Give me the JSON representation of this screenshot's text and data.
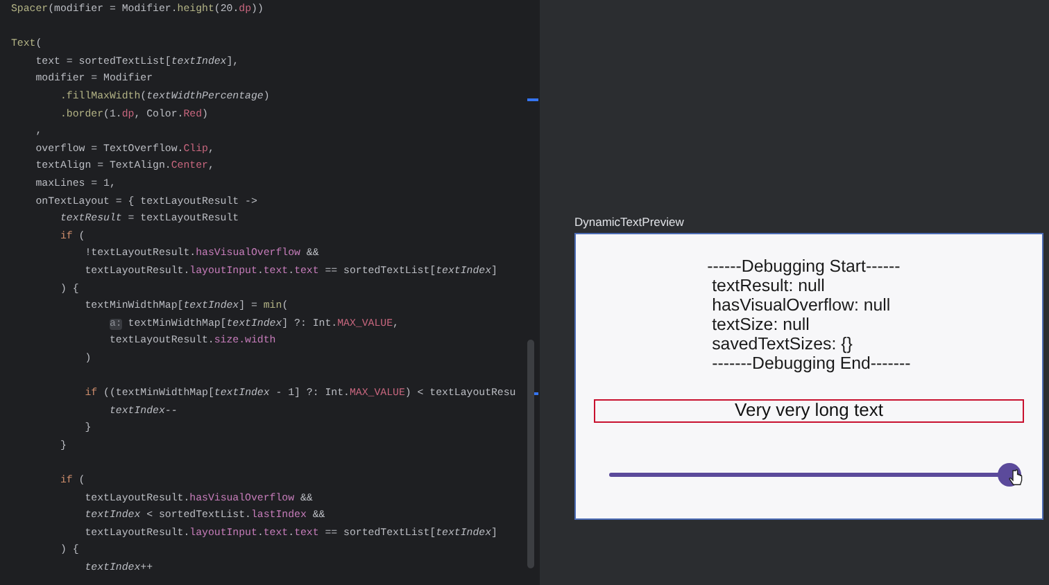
{
  "editor": {
    "lines": [
      {
        "tokens": [
          {
            "t": "Spacer",
            "kind": "fn"
          },
          {
            "t": "(modifier = Modifier.",
            "kind": "p"
          },
          {
            "t": "height",
            "kind": "fn"
          },
          {
            "t": "(20.",
            "kind": "p"
          },
          {
            "t": "dp",
            "kind": "c"
          },
          {
            "t": "))",
            "kind": "p"
          }
        ]
      },
      {
        "kind": "blank"
      },
      {
        "kind": "code",
        "tokens": [
          {
            "t": "Text",
            "kind": "fn"
          },
          {
            "t": "(",
            "kind": "p"
          }
        ]
      },
      {
        "tokens": [
          {
            "t": "    text = sortedTextList[",
            "kind": "p"
          },
          {
            "t": "textIndex",
            "kind": "i"
          },
          {
            "t": "],",
            "kind": "p"
          }
        ]
      },
      {
        "tokens": [
          {
            "t": "    modifier = Modifier",
            "kind": "p"
          }
        ]
      },
      {
        "tokens": [
          {
            "t": "        .fillMaxWidth",
            "kind": "fn"
          },
          {
            "t": "(",
            "kind": "p"
          },
          {
            "t": "textWidthPercentage",
            "kind": "i"
          },
          {
            "t": ")",
            "kind": "p"
          }
        ]
      },
      {
        "tokens": [
          {
            "t": "        .border",
            "kind": "fn"
          },
          {
            "t": "(1.",
            "kind": "p"
          },
          {
            "t": "dp",
            "kind": "c"
          },
          {
            "t": ", Color.",
            "kind": "p"
          },
          {
            "t": "Red",
            "kind": "c"
          },
          {
            "t": ")",
            "kind": "p"
          }
        ]
      },
      {
        "tokens": [
          {
            "t": "    ,",
            "kind": "p"
          }
        ]
      },
      {
        "tokens": [
          {
            "t": "    overflow = TextOverflow.",
            "kind": "p"
          },
          {
            "t": "Clip",
            "kind": "c"
          },
          {
            "t": ",",
            "kind": "p"
          }
        ]
      },
      {
        "tokens": [
          {
            "t": "    textAlign = TextAlign.",
            "kind": "p"
          },
          {
            "t": "Center",
            "kind": "c"
          },
          {
            "t": ",",
            "kind": "p"
          }
        ]
      },
      {
        "tokens": [
          {
            "t": "    maxLines = 1,",
            "kind": "p"
          }
        ]
      },
      {
        "tokens": [
          {
            "t": "    onTextLayout = { textLayoutResult ->",
            "kind": "p"
          }
        ]
      },
      {
        "tokens": [
          {
            "t": "        textResult",
            "kind": "i"
          },
          {
            "t": " = textLayoutResult",
            "kind": "p"
          }
        ]
      },
      {
        "tokens": [
          {
            "t": "        if",
            "kind": "kw"
          },
          {
            "t": " (",
            "kind": "p"
          }
        ]
      },
      {
        "tokens": [
          {
            "t": "            !textLayoutResult.",
            "kind": "p"
          },
          {
            "t": "hasVisualOverflow",
            "kind": "prop"
          },
          {
            "t": " &&",
            "kind": "p"
          }
        ]
      },
      {
        "tokens": [
          {
            "t": "            textLayoutResult.",
            "kind": "p"
          },
          {
            "t": "layoutInput",
            "kind": "prop"
          },
          {
            "t": ".",
            "kind": "p"
          },
          {
            "t": "text",
            "kind": "prop"
          },
          {
            "t": ".",
            "kind": "p"
          },
          {
            "t": "text",
            "kind": "prop"
          },
          {
            "t": " == sortedTextList[",
            "kind": "p"
          },
          {
            "t": "textIndex",
            "kind": "i"
          },
          {
            "t": "]",
            "kind": "p"
          }
        ]
      },
      {
        "tokens": [
          {
            "t": "        ) {",
            "kind": "p"
          }
        ]
      },
      {
        "tokens": [
          {
            "t": "            textMinWidthMap[",
            "kind": "p"
          },
          {
            "t": "textIndex",
            "kind": "i"
          },
          {
            "t": "] = ",
            "kind": "p"
          },
          {
            "t": "min",
            "kind": "fn"
          },
          {
            "t": "(",
            "kind": "p"
          }
        ]
      },
      {
        "tokens": [
          {
            "t": "                a:",
            "kind": "hint"
          },
          {
            "t": " textMinWidthMap[",
            "kind": "p"
          },
          {
            "t": "textIndex",
            "kind": "i"
          },
          {
            "t": "] ?: Int.",
            "kind": "p"
          },
          {
            "t": "MAX_VALUE",
            "kind": "c"
          },
          {
            "t": ",",
            "kind": "p"
          }
        ]
      },
      {
        "tokens": [
          {
            "t": "                textLayoutResult.",
            "kind": "p"
          },
          {
            "t": "size.width",
            "kind": "prop"
          }
        ]
      },
      {
        "tokens": [
          {
            "t": "            )",
            "kind": "p"
          }
        ]
      },
      {
        "kind": "blank"
      },
      {
        "kind": "code",
        "tokens": [
          {
            "t": "            if",
            "kind": "kw"
          },
          {
            "t": " ((textMinWidthMap[",
            "kind": "p"
          },
          {
            "t": "textIndex",
            "kind": "i"
          },
          {
            "t": " - 1] ?: Int.",
            "kind": "p"
          },
          {
            "t": "MAX_VALUE",
            "kind": "c"
          },
          {
            "t": ") < textLayoutResu",
            "kind": "p"
          }
        ]
      },
      {
        "tokens": [
          {
            "t": "                textIndex--",
            "kind": "i"
          }
        ]
      },
      {
        "tokens": [
          {
            "t": "            }",
            "kind": "p"
          }
        ]
      },
      {
        "tokens": [
          {
            "t": "        }",
            "kind": "p"
          }
        ]
      },
      {
        "kind": "blank"
      },
      {
        "kind": "code",
        "tokens": [
          {
            "t": "        if",
            "kind": "kw"
          },
          {
            "t": " (",
            "kind": "p"
          }
        ]
      },
      {
        "tokens": [
          {
            "t": "            textLayoutResult.",
            "kind": "p"
          },
          {
            "t": "hasVisualOverflow",
            "kind": "prop"
          },
          {
            "t": " &&",
            "kind": "p"
          }
        ]
      },
      {
        "tokens": [
          {
            "t": "            textIndex",
            "kind": "i"
          },
          {
            "t": " < sortedTextList.",
            "kind": "p"
          },
          {
            "t": "lastIndex",
            "kind": "prop"
          },
          {
            "t": " &&",
            "kind": "p"
          }
        ]
      },
      {
        "tokens": [
          {
            "t": "            textLayoutResult.",
            "kind": "p"
          },
          {
            "t": "layoutInput",
            "kind": "prop"
          },
          {
            "t": ".",
            "kind": "p"
          },
          {
            "t": "text",
            "kind": "prop"
          },
          {
            "t": ".",
            "kind": "p"
          },
          {
            "t": "text",
            "kind": "prop"
          },
          {
            "t": " == sortedTextList[",
            "kind": "p"
          },
          {
            "t": "textIndex",
            "kind": "i"
          },
          {
            "t": "]",
            "kind": "p"
          }
        ]
      },
      {
        "tokens": [
          {
            "t": "        ) {",
            "kind": "p"
          }
        ]
      },
      {
        "tokens": [
          {
            "t": "            textIndex++",
            "kind": "i"
          }
        ]
      }
    ]
  },
  "preview": {
    "title": "DynamicTextPreview",
    "debug_lines": [
      "------Debugging Start------",
      " textResult: null",
      " hasVisualOverflow: null",
      " textSize: null",
      " savedTextSizes: {}",
      " -------Debugging End-------"
    ],
    "sample_text": "Very very long text",
    "slider": {
      "level": 0.98
    }
  }
}
